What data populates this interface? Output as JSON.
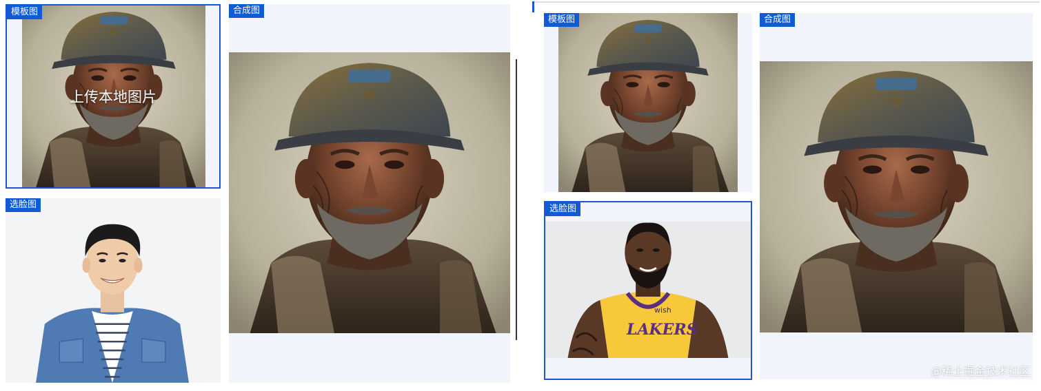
{
  "left_group": {
    "template_tag": "模板图",
    "upload_text": "上传本地图片",
    "face_tag": "选脸图",
    "result_tag": "合成图"
  },
  "right_group": {
    "template_tag": "模板图",
    "face_tag": "选脸图",
    "result_tag": "合成图",
    "jersey_text": "LAKERS",
    "jersey_sponsor": "wish"
  },
  "watermark": "@稀土掘金技术社区",
  "colors": {
    "accent": "#0f5bd6",
    "panel_bg": "#f1f4fa"
  }
}
